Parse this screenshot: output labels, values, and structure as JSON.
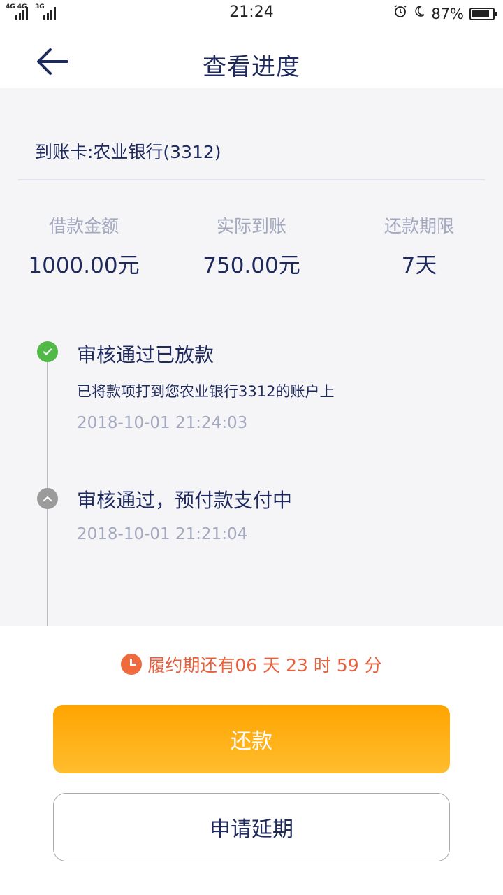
{
  "status_bar": {
    "signal_1_label": "4G 4G",
    "signal_2_label": "3G",
    "time": "21:24",
    "alarm_icon": "alarm-icon",
    "moon_icon": "moon-icon",
    "battery_pct": "87%",
    "battery_level": 0.87
  },
  "header": {
    "back_icon": "arrow-left-icon",
    "title": "查看进度"
  },
  "account": {
    "card_text": "到账卡:农业银行(3312)"
  },
  "stats": [
    {
      "label": "借款金额",
      "value": "1000.00元"
    },
    {
      "label": "实际到账",
      "value": "750.00元"
    },
    {
      "label": "还款期限",
      "value": "7天"
    }
  ],
  "timeline": [
    {
      "icon": "check-icon",
      "title": "审核通过已放款",
      "description": "已将款项打到您农业银行3312的账户上",
      "time": "2018-10-01 21:24:03"
    },
    {
      "icon": "chevron-up-icon",
      "title": "审核通过，预付款支付中",
      "time": "2018-10-01 21:21:04"
    }
  ],
  "countdown": {
    "icon": "clock-icon",
    "text": "履约期还有06 天 23 时 59 分"
  },
  "actions": {
    "repay_label": "还款",
    "extend_label": "申请延期"
  },
  "colors": {
    "primary_text": "#1f2a5c",
    "muted_text": "#a3a8bf",
    "accent_orange": "#ffa400",
    "countdown_red": "#e6603c",
    "success_green": "#52b848"
  }
}
